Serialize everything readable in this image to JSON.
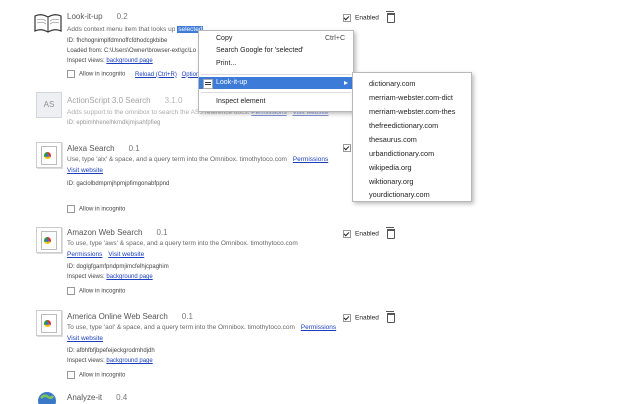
{
  "extensions": [
    {
      "title": "Look-it-up",
      "version": "0.2",
      "description_prefix": "Adds context menu item that looks up",
      "selected_text": "selected",
      "id_line": "ID: fhchognimplfdmnoffcfdhodcgkbibe",
      "loaded_line": "Loaded from: C:\\Users\\Owner\\browser-ext\\gc\\Lo",
      "inspect_label": "Inspect views:",
      "inspect_link": "background page",
      "incognito_label": "Allow in incognito",
      "reload_link": "Reload (Ctrl+R)",
      "options_link": "Options",
      "enabled_label": "Enabled",
      "enabled": true
    },
    {
      "title": "ActionScript 3.0 Search",
      "version": "3.1.0",
      "description": "Adds support to the omnibox to search the AS3 reference docs.",
      "links": [
        "Permissions",
        "Visit website"
      ],
      "id_line": "ID: epbimhhenelhkmdkjmjsahfpfieg",
      "enabled": false
    },
    {
      "title": "Alexa Search",
      "version": "0.1",
      "description": "Use, type 'alx' & space, and a query term into the Omnibox. timothytoco.com",
      "links": [
        "Permissions",
        "Visit website"
      ],
      "id_line": "ID: gaclolbdmpmjhpmjpfimgonabfppnd",
      "incognito_label": "Allow in incognito",
      "enabled": true
    },
    {
      "title": "Amazon Web Search",
      "version": "0.1",
      "description": "To use, type 'aws' & space, and a query term into the Omnibox. timothytoco.com",
      "links": [
        "Permissions",
        "Visit website"
      ],
      "id_line": "ID: doglgfgamfpndpmjimcfelhjcpaghim",
      "incognito_label": "Allow in incognito",
      "enabled_label": "Enabled",
      "enabled": true
    },
    {
      "title": "America Online Web Search",
      "version": "0.1",
      "description": "To use, type 'aol' & space, and a query term into the Omnibox. timothytoco.com",
      "links": [
        "Permissions",
        "Visit website"
      ],
      "id_line": "ID: afbhfbfjbpefeijeckgrodmhdjdh",
      "incognito_label": "Allow in incognito",
      "enabled_label": "Enabled",
      "enabled": true
    },
    {
      "title": "Analyze-it",
      "version": "0.4"
    }
  ],
  "context_menu": {
    "items": [
      {
        "label": "Copy",
        "shortcut": "Ctrl+C"
      },
      {
        "label": "Search Google for 'selected'"
      },
      {
        "label": "Print..."
      },
      {
        "label": "Look-it-up"
      },
      {
        "label": "Inspect element"
      }
    ],
    "submenu": [
      "dictionary.com",
      "merriam-webster.com-dict",
      "merriam-webster.com-thes",
      "thefreedictionary.com",
      "thesaurus.com",
      "urbandictionary.com",
      "wikipedia.org",
      "wiktionary.org",
      "yourdictionary.com"
    ]
  }
}
